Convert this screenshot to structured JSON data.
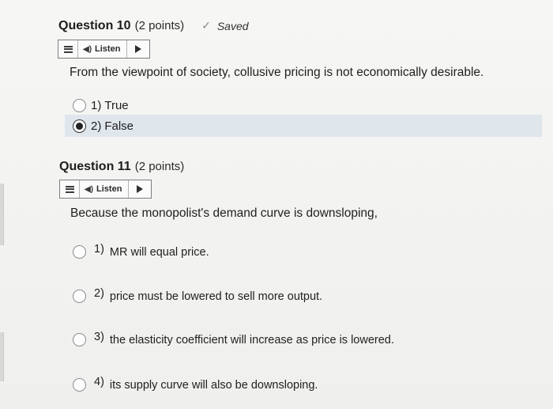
{
  "questions": [
    {
      "title": "Question 10",
      "points": "(2 points)",
      "saved": "Saved",
      "listen": {
        "label": "Listen"
      },
      "prompt": "From the viewpoint of society, collusive pricing is not economically desirable.",
      "options": [
        {
          "num": "1)",
          "text": "True",
          "selected": false
        },
        {
          "num": "2)",
          "text": "False",
          "selected": true
        }
      ]
    },
    {
      "title": "Question 11",
      "points": "(2 points)",
      "listen": {
        "label": "Listen"
      },
      "prompt": "Because the monopolist's demand curve is downsloping,",
      "options": [
        {
          "num": "1)",
          "text": "MR will equal price.",
          "selected": false
        },
        {
          "num": "2)",
          "text": "price must be lowered to sell more output.",
          "selected": false
        },
        {
          "num": "3)",
          "text": "the elasticity coefficient will increase as price is lowered.",
          "selected": false
        },
        {
          "num": "4)",
          "text": "its supply curve will also be downsloping.",
          "selected": false
        }
      ]
    }
  ],
  "icons": {
    "check": "checkmark-icon",
    "menu": "menu-icon",
    "speaker": "speaker-icon",
    "play": "play-icon"
  },
  "colors": {
    "selected_row": "#dfe6ec",
    "background": "#f3f3f1"
  }
}
